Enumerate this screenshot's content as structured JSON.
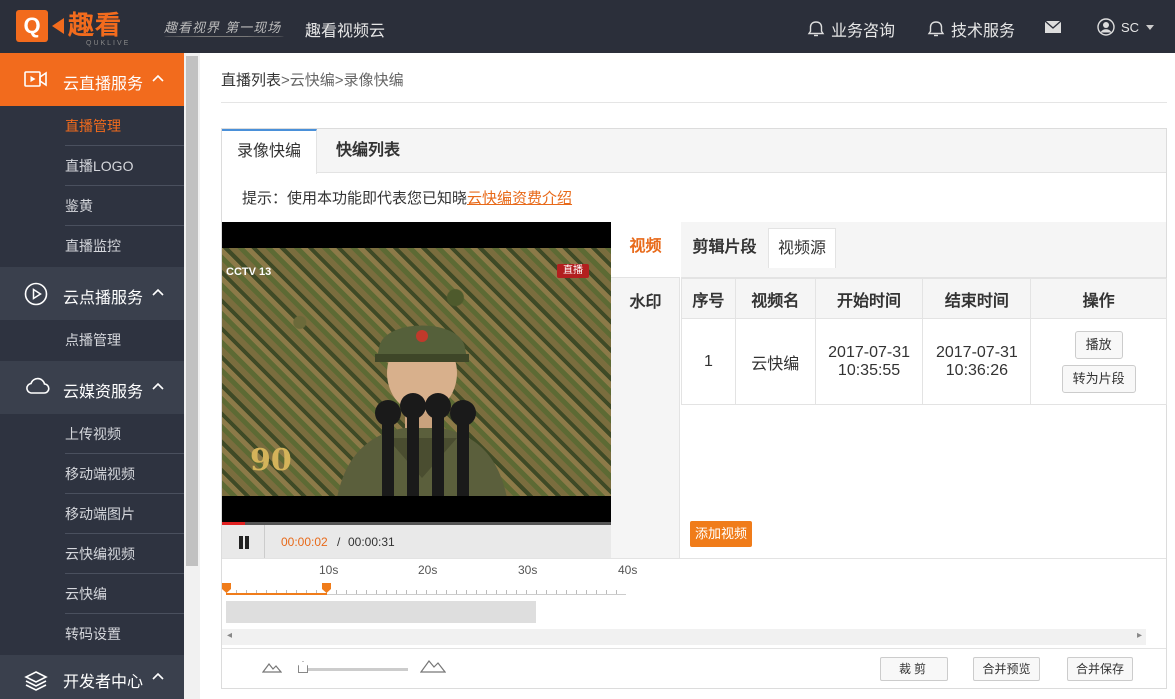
{
  "header": {
    "logo_letter": "Q",
    "logo_text": "趣看",
    "logo_sub": "QUKLIVE",
    "slogan": "趣看视界 第一现场",
    "brand": "趣看视频云",
    "nav_consult": "业务咨询",
    "nav_tech": "技术服务",
    "user": "SC",
    "brand_color": "#f26b1d"
  },
  "sidebar": {
    "sections": [
      {
        "label": "云直播服务",
        "icon": "video-camera-icon",
        "expanded": true,
        "items": [
          "直播管理",
          "直播LOGO",
          "鉴黄",
          "直播监控"
        ],
        "active_item": "直播管理"
      },
      {
        "label": "云点播服务",
        "icon": "play-circle-icon",
        "expanded": true,
        "items": [
          "点播管理"
        ]
      },
      {
        "label": "云媒资服务",
        "icon": "cloud-icon",
        "expanded": true,
        "items": [
          "上传视频",
          "移动端视频",
          "移动端图片",
          "云快编视频",
          "云快编",
          "转码设置"
        ]
      },
      {
        "label": "开发者中心",
        "icon": "layers-icon",
        "expanded": true,
        "items": []
      }
    ]
  },
  "breadcrumb": {
    "c1": "直播列表",
    "sep": ">",
    "c2": "云快编",
    "c3": "录像快编"
  },
  "tabs": {
    "record": "录像快编",
    "list": "快编列表"
  },
  "hint": {
    "prefix": "提示：使用本功能即代表您已知晓",
    "link": "云快编资费介绍"
  },
  "player": {
    "channel": "CCTV 13",
    "live_tag": "直播",
    "emblem_text": "90",
    "current_time": "00:00:02",
    "separator": "/",
    "total_time": "00:00:31",
    "progress_fraction": 0.06
  },
  "side_tabs": {
    "video": "视频",
    "watermark": "水印"
  },
  "sub_tabs": {
    "clips": "剪辑片段",
    "source": "视频源"
  },
  "table": {
    "headers": [
      "序号",
      "视频名",
      "开始时间",
      "结束时间",
      "操作"
    ],
    "rows": [
      {
        "index": "1",
        "name": "云快编",
        "start_date": "2017-07-31",
        "start_time": "10:35:55",
        "end_date": "2017-07-31",
        "end_time": "10:36:26",
        "play": "播放",
        "to_clip": "转为片段"
      }
    ]
  },
  "add_video": "添加视频",
  "timeline": {
    "ticks": [
      "10s",
      "20s",
      "30s",
      "40s"
    ]
  },
  "footer": {
    "crop": "裁剪",
    "merge_preview": "合并预览",
    "merge_save": "合并保存"
  }
}
